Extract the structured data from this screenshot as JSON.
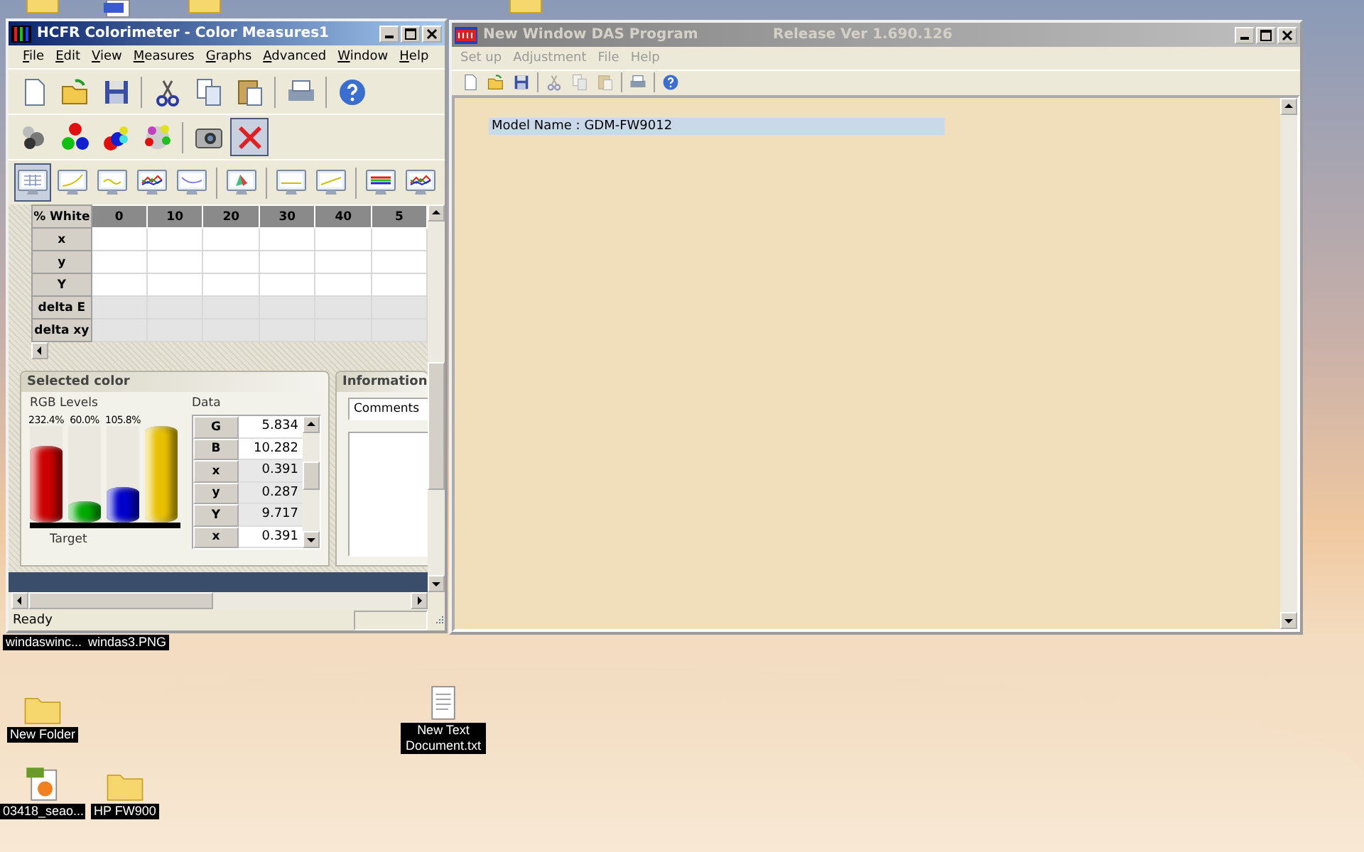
{
  "desktop": {
    "icons": [
      {
        "label": "windaswinc...",
        "kind": "image"
      },
      {
        "label": "windas3.PNG",
        "kind": "image"
      },
      {
        "label": "New Folder",
        "kind": "folder"
      },
      {
        "label": "New Text Document.txt",
        "kind": "text"
      },
      {
        "label": "03418_seao...",
        "kind": "jpg"
      },
      {
        "label": "HP FW900",
        "kind": "folder"
      }
    ]
  },
  "hcfr_window": {
    "title": "HCFR Colorimeter - Color Measures1",
    "active": true,
    "menu": [
      "File",
      "Edit",
      "View",
      "Measures",
      "Graphs",
      "Advanced",
      "Window",
      "Help"
    ],
    "toolbars": [
      {
        "items": [
          {
            "kind": "new",
            "selected": false
          },
          {
            "kind": "open",
            "selected": false
          },
          {
            "kind": "save",
            "selected": false
          },
          {
            "kind": "sep"
          },
          {
            "kind": "cut",
            "selected": false
          },
          {
            "kind": "copy",
            "selected": false
          },
          {
            "kind": "paste",
            "selected": false
          },
          {
            "kind": "sep"
          },
          {
            "kind": "print",
            "selected": false
          },
          {
            "kind": "sep"
          },
          {
            "kind": "help",
            "selected": false
          }
        ]
      },
      {
        "items": [
          {
            "kind": "spheres-grey",
            "selected": false
          },
          {
            "kind": "spheres-rgb",
            "selected": false
          },
          {
            "kind": "spheres-mix",
            "selected": false
          },
          {
            "kind": "spheres-ring",
            "selected": false
          },
          {
            "kind": "sep"
          },
          {
            "kind": "camera",
            "selected": false
          },
          {
            "kind": "stop",
            "selected": true
          }
        ]
      },
      {
        "items": [
          {
            "kind": "monitor-table",
            "selected": true
          },
          {
            "kind": "monitor-curve",
            "selected": false
          },
          {
            "kind": "monitor-wave",
            "selected": false
          },
          {
            "kind": "monitor-rgb",
            "selected": false
          },
          {
            "kind": "monitor-line",
            "selected": false
          },
          {
            "kind": "sep"
          },
          {
            "kind": "monitor-gamut",
            "selected": false
          },
          {
            "kind": "sep"
          },
          {
            "kind": "monitor-flat",
            "selected": false
          },
          {
            "kind": "monitor-rise",
            "selected": false
          },
          {
            "kind": "sep"
          },
          {
            "kind": "monitor-bands",
            "selected": false
          },
          {
            "kind": "monitor-rgb",
            "selected": false
          }
        ]
      }
    ],
    "table": {
      "columns": [
        "% White",
        "0",
        "10",
        "20",
        "30",
        "40",
        "5"
      ],
      "rows": [
        {
          "label": "x",
          "shaded": false
        },
        {
          "label": "y",
          "shaded": false
        },
        {
          "label": "Y",
          "shaded": false
        },
        {
          "label": "delta E",
          "shaded": true
        },
        {
          "label": "delta xy",
          "shaded": true
        }
      ]
    },
    "selected_color": {
      "title": "Selected color",
      "levels_label": "RGB Levels",
      "data_label": "Data",
      "target_label": "Target",
      "bars": [
        {
          "reading": "232.4%",
          "level": 0.8,
          "color": "#cc0000"
        },
        {
          "reading": "60.0%",
          "level": 0.22,
          "color": "#00aa00"
        },
        {
          "reading": "105.8%",
          "level": 0.37,
          "color": "#0000cc"
        },
        {
          "color": "#e8c000"
        }
      ],
      "data_rows": [
        {
          "name": "G",
          "value": "5.834",
          "shaded": false
        },
        {
          "name": "B",
          "value": "10.282",
          "shaded": false
        },
        {
          "name": "x",
          "value": "0.391",
          "shaded": true
        },
        {
          "name": "y",
          "value": "0.287",
          "shaded": true
        },
        {
          "name": "Y",
          "value": "9.717",
          "shaded": true
        },
        {
          "name": "x",
          "value": "0.391",
          "shaded": false
        }
      ]
    },
    "information": {
      "title": "Information",
      "dropdown": "Comments"
    },
    "status": "Ready"
  },
  "das_window": {
    "title": "New Window DAS Program",
    "release": "Release Ver 1.690.126",
    "active": false,
    "menu": [
      {
        "label": "Set up",
        "disabled": true
      },
      {
        "label": "Adjustment",
        "disabled": true
      },
      {
        "label": "File",
        "disabled": true
      },
      {
        "label": "Help",
        "disabled": true
      }
    ],
    "toolbar": [
      {
        "kind": "new",
        "disabled": false
      },
      {
        "kind": "open",
        "disabled": false
      },
      {
        "kind": "save",
        "disabled": false
      },
      {
        "kind": "sep"
      },
      {
        "kind": "cut",
        "disabled": true
      },
      {
        "kind": "copy",
        "disabled": true
      },
      {
        "kind": "paste",
        "disabled": true
      },
      {
        "kind": "sep"
      },
      {
        "kind": "print",
        "disabled": false
      },
      {
        "kind": "sep"
      },
      {
        "kind": "help",
        "disabled": false
      }
    ],
    "model_line": "Model Name : GDM-FW9012"
  }
}
